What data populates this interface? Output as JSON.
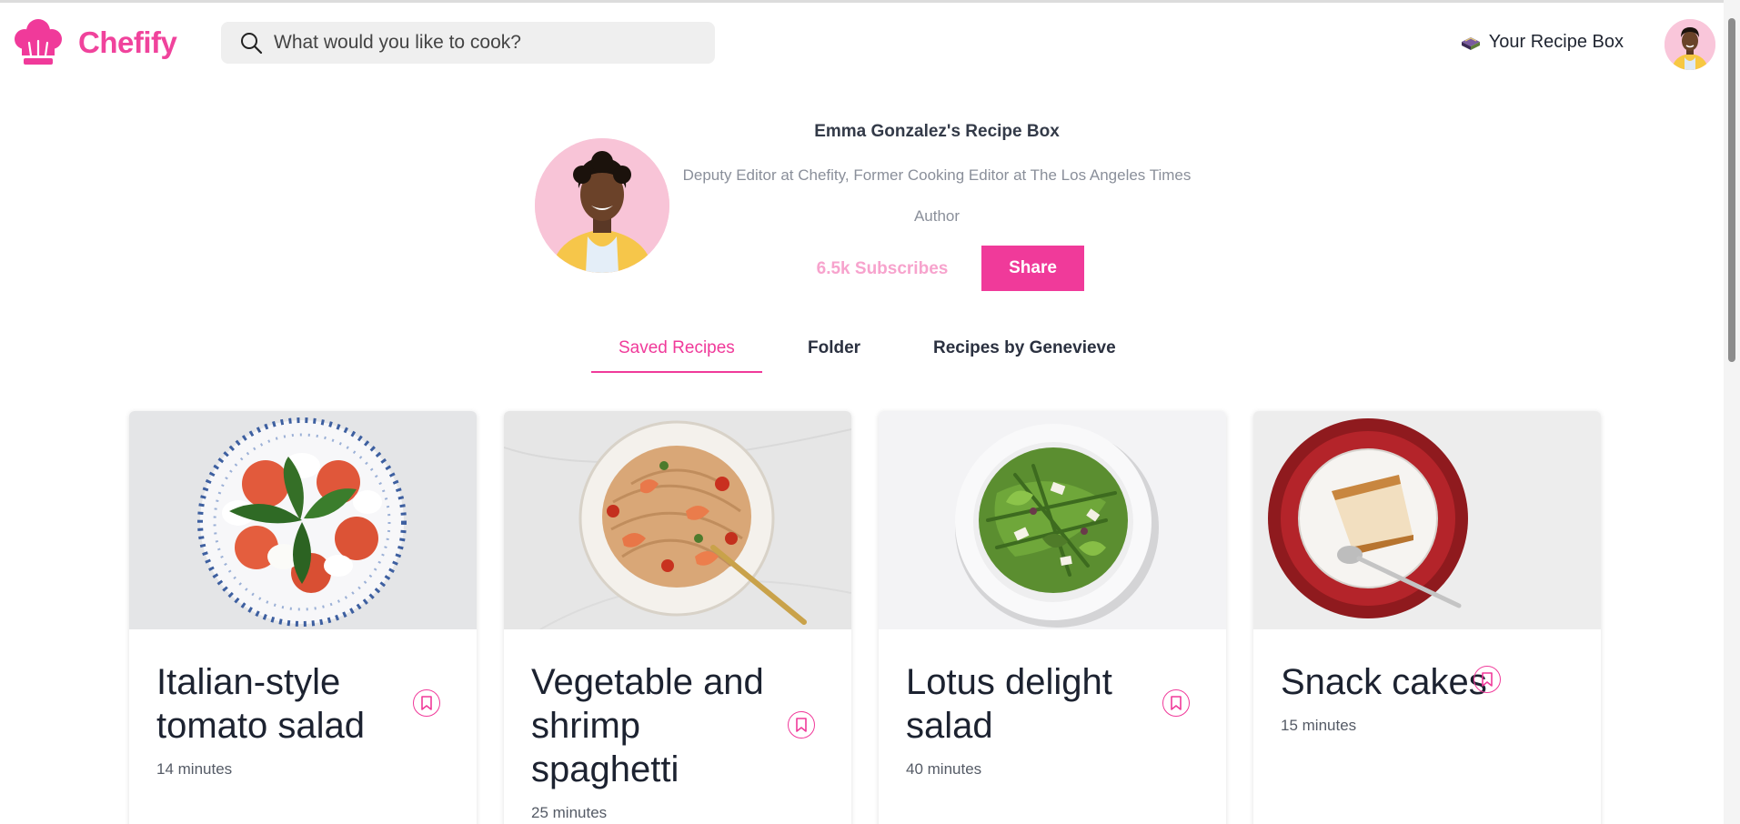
{
  "app": {
    "name": "Chefify",
    "brand_color": "#f03a9a"
  },
  "search": {
    "placeholder": "What would you like to cook?"
  },
  "header": {
    "recipe_box_label": "Your Recipe Box"
  },
  "profile": {
    "title": "Emma Gonzalez's Recipe Box",
    "bio": "Deputy Editor at Chefity, Former Cooking Editor at The Los Angeles Times",
    "role": "Author",
    "subscribers": "6.5k Subscribes",
    "share_label": "Share"
  },
  "tabs": [
    {
      "label": "Saved Recipes",
      "active": true
    },
    {
      "label": "Folder",
      "active": false
    },
    {
      "label": "Recipes by Genevieve",
      "active": false
    }
  ],
  "recipes": [
    {
      "title": "Italian-style tomato salad",
      "time": "14 minutes",
      "image": "tomato-salad"
    },
    {
      "title": "Vegetable and shrimp spaghetti",
      "time": "25 minutes",
      "image": "shrimp-spaghetti"
    },
    {
      "title": "Lotus delight salad",
      "time": "40 minutes",
      "image": "green-salad"
    },
    {
      "title": "Snack cakes",
      "time": "15 minutes",
      "image": "cake-slice"
    }
  ],
  "icons": {
    "logo": "chef-hat-icon",
    "search": "search-icon",
    "recipe_box": "recipe-box-icon",
    "bookmark": "bookmark-icon"
  }
}
